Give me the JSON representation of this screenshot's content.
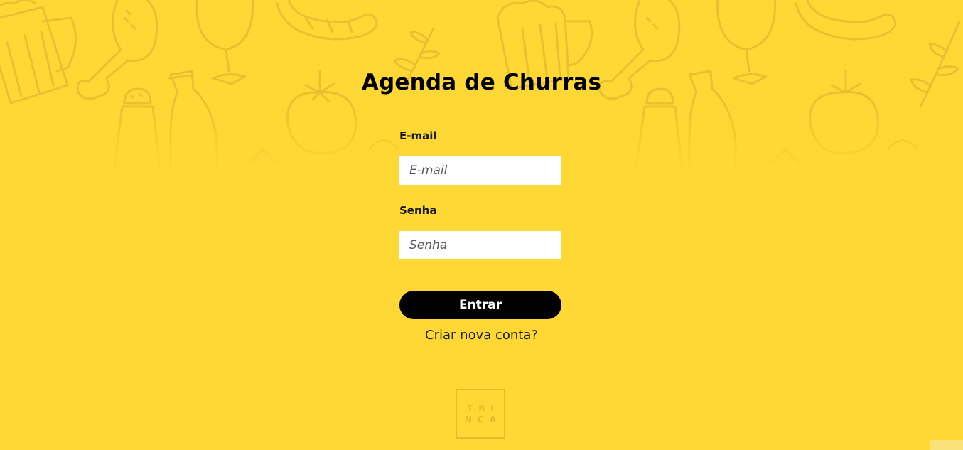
{
  "app": {
    "title": "Agenda de Churras"
  },
  "form": {
    "email_label": "E-mail",
    "email_placeholder": "E-mail",
    "email_value": "",
    "password_label": "Senha",
    "password_placeholder": "Senha",
    "password_value": "",
    "submit_label": "Entrar",
    "signup_link": "Criar nova conta?"
  },
  "brand": {
    "logo_line1": "TRI",
    "logo_line2": "NCA"
  },
  "colors": {
    "background": "#FFD836",
    "doodle_stroke": "#E8C22E",
    "button_bg": "#000000",
    "button_text": "#FFFFFF"
  },
  "background_icons": [
    "beer-mug-icon",
    "chicken-leg-icon",
    "wine-glass-icon",
    "sausage-icon",
    "salt-shaker-icon",
    "bottle-icon",
    "tomato-icon",
    "herb-icon"
  ]
}
